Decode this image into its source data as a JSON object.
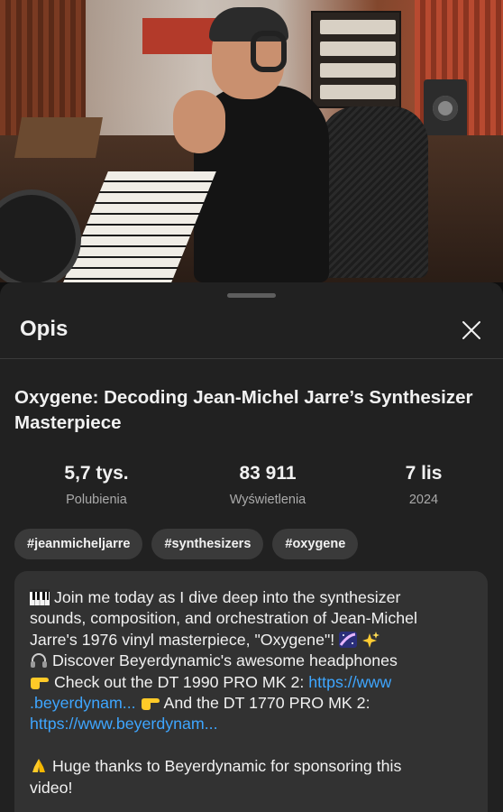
{
  "sheet": {
    "header_title": "Opis",
    "video_title": "Oxygene: Decoding Jean-Michel Jarre’s Synthesizer Masterpiece",
    "stats": {
      "likes_value": "5,7 tys.",
      "likes_label": "Polubienia",
      "views_value": "83 911",
      "views_label": "Wyświetlenia",
      "date_value": "7 lis",
      "date_label": "2024"
    },
    "tags": [
      "#jeanmicheljarre",
      "#synthesizers",
      "#oxygene"
    ],
    "description": {
      "line1": "Join me today as I dive deep into the synthesizer",
      "line2": "sounds, composition, and orchestration of Jean-Michel",
      "line3": "Jarre's 1976 vinyl masterpiece, \"Oxygene\"!",
      "line4": "Discover Beyerdynamic's awesome headphones",
      "line5": "Check out the DT 1990 PRO MK 2: ",
      "link1a": "https://www",
      "link1b": ".beyerdynam...",
      "line6": "And the DT 1770 PRO MK 2:",
      "link2": "https://www.beyerdynam...",
      "line7": "Huge thanks to Beyerdynamic for sponsoring this",
      "line8": "video!"
    }
  },
  "icons": {
    "close": "close-icon",
    "piano": "piano-emoji",
    "milky_way": "milky-way-emoji",
    "sparkles": "sparkles-emoji",
    "headphones": "headphones-emoji",
    "point_right": "backhand-index-pointing-right-emoji",
    "pray": "folded-hands-emoji"
  },
  "colors": {
    "background": "#0f0f0f",
    "sheet": "#212121",
    "chip": "#3a3a3a",
    "description_box": "#323232",
    "link": "#3ea6ff",
    "secondary_text": "#aaaaaa"
  }
}
